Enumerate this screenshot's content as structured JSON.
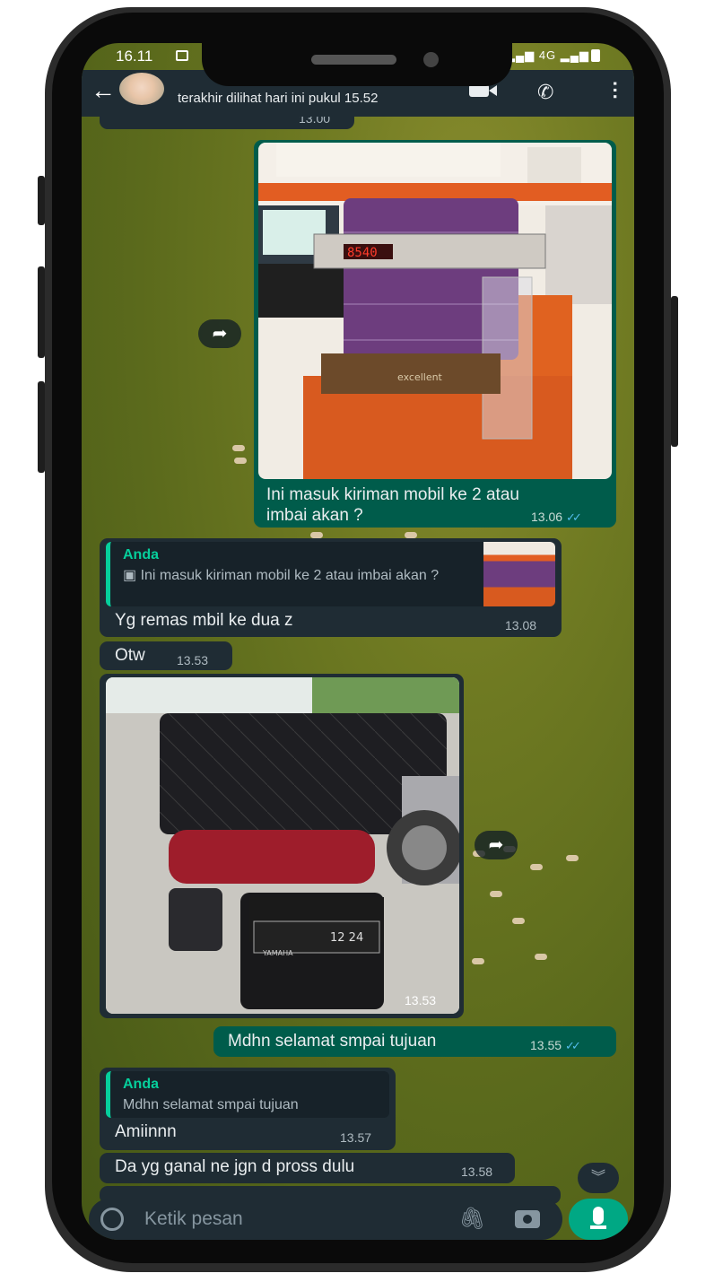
{
  "status_bar": {
    "time": "16.11",
    "network": "4G"
  },
  "header": {
    "back_icon": "arrow-left-icon",
    "last_seen": "terakhir dilihat hari ini pukul 15.52"
  },
  "messages": {
    "top_cut_time": "13.00",
    "m1": {
      "text": "Ini masuk kiriman mobil ke 2 atau imbai akan ?",
      "time": "13.06"
    },
    "m2": {
      "quote_name": "Anda",
      "quote_text": "Ini masuk kiriman mobil ke 2 atau imbai akan ?",
      "text": "Yg remas mbil ke dua z",
      "time": "13.08"
    },
    "m3": {
      "text": "Otw",
      "time": "13.53"
    },
    "m4": {
      "time": "13.53",
      "plate": "12 24",
      "brand": "YAMAHA"
    },
    "m5": {
      "text": "Mdhn selamat smpai tujuan",
      "time": "13.55"
    },
    "m6": {
      "quote_name": "Anda",
      "quote_text": "Mdhn selamat smpai tujuan",
      "text": "Amiinnn",
      "time": "13.57"
    },
    "m7": {
      "text": "Da yg ganal ne jgn d pross dulu",
      "time": "13.58"
    }
  },
  "scale": {
    "display": "8540",
    "brand": "excellent"
  },
  "composer": {
    "placeholder": "Ketik pesan"
  },
  "colors": {
    "incoming": "#1f2c34",
    "outgoing": "#005c4b",
    "accent": "#00a884"
  }
}
